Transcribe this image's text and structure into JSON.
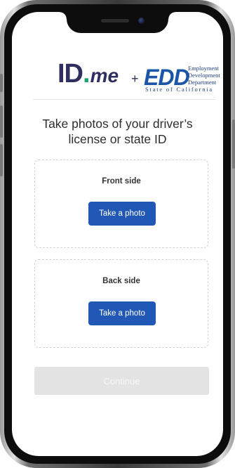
{
  "header": {
    "idme_logo": {
      "id": "ID",
      "dot": ".",
      "me": "me"
    },
    "plus": "+",
    "edd_logo": {
      "mark": "EDD",
      "lines": [
        "Employment",
        "Development",
        "Department"
      ],
      "state": "State of California"
    }
  },
  "page": {
    "title": "Take photos of your driver’s license or state ID"
  },
  "front": {
    "label": "Front side",
    "button": "Take a photo"
  },
  "back": {
    "label": "Back side",
    "button": "Take a photo"
  },
  "continue_button": {
    "label": "Continue",
    "state": "disabled"
  },
  "colors": {
    "primary_button": "#2258b5",
    "idme_navy": "#2e2f5f",
    "idme_green": "#17a673",
    "edd_blue": "#1a55a8",
    "disabled_button": "#e3e3e3"
  }
}
